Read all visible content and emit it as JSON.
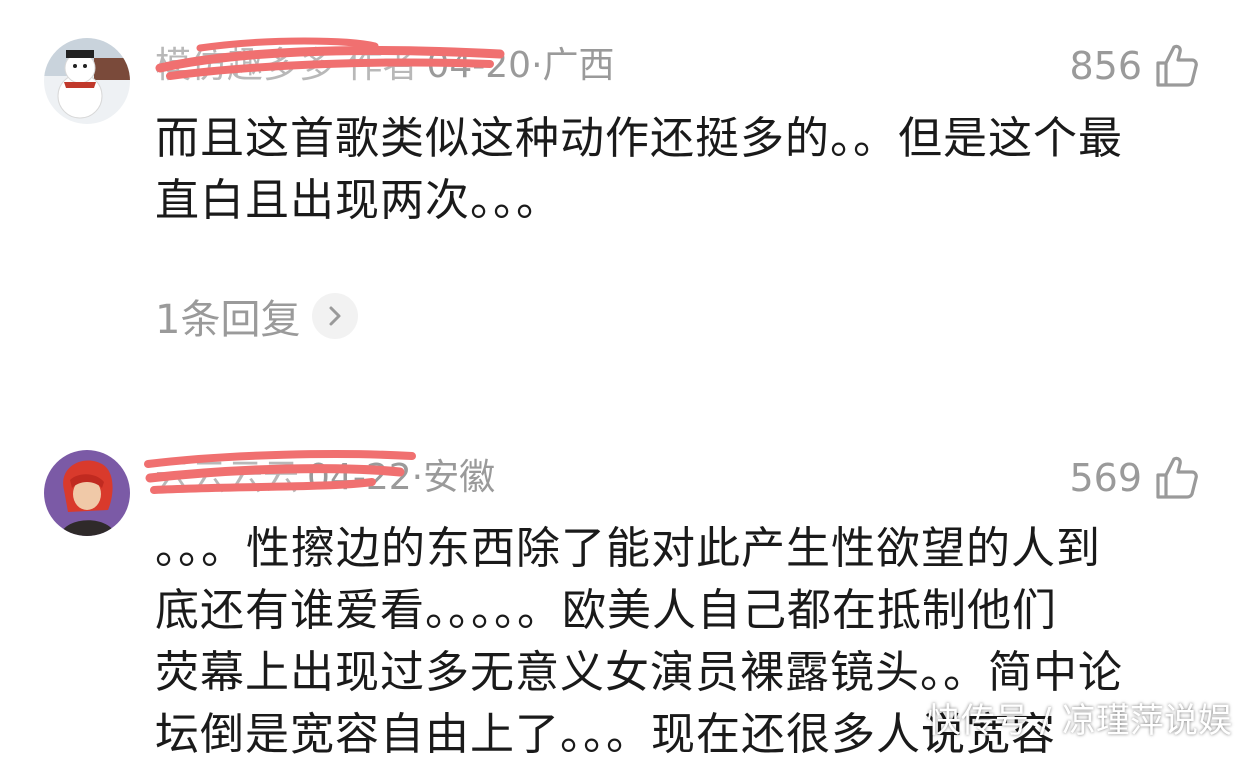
{
  "comments": [
    {
      "author": "模仿趣多多 作者",
      "date": "04-20",
      "location": "广西",
      "likes": "856",
      "text_lines": [
        "而且这首歌类似这种动作还挺多的。。但是这个最",
        "直白且出现两次。。。"
      ],
      "replies_label": "1条回复",
      "avatar_icon": "snowman-avatar-icon"
    },
    {
      "author": "云云云云",
      "date": "04-22",
      "location": "安徽",
      "likes": "569",
      "text_lines": [
        "。。。性擦边的东西除了能对此产生性欲望的人到",
        "底还有谁爱看。。。。。欧美人自己都在抵制他们",
        "荧幕上出现过多无意义女演员裸露镜头。。简中论",
        "坛倒是宽容自由上了。。。现在还很多人说宽容"
      ],
      "avatar_icon": "anime-character-avatar-icon"
    }
  ],
  "separator": "·",
  "watermark": "快传号 / 凉瑾萍说娱",
  "colors": {
    "meta": "#9a9a9a",
    "redact": "#f07070",
    "text": "#1a1a1a"
  }
}
